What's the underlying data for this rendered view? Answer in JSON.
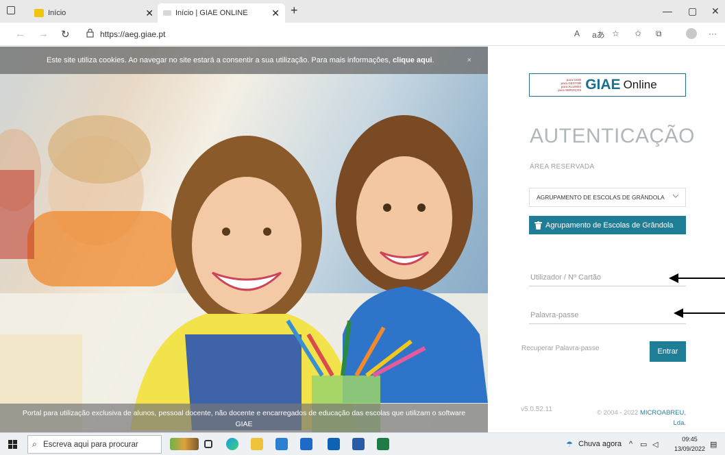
{
  "browser": {
    "tabs": [
      {
        "title": "Início"
      },
      {
        "title": "Início | GIAE ONLINE"
      }
    ],
    "url": "https://aeg.giae.pt",
    "reader_label": "A",
    "translate_label": "aあ"
  },
  "cookie_banner": {
    "text": "Este site utiliza cookies. Ao navegar no site estará a consentir a sua utilização. Para mais informações,",
    "link": "clique aqui",
    "close": "×"
  },
  "footer_note": "Portal para utilização exclusiva de alunos, pessoal docente, não docente e encarregados de educação das escolas que utilizam o software GIAE",
  "login": {
    "logo_tagline": [
      "para GIAE",
      "para GESTOR",
      "para ALUNOS",
      "para SERVIÇOS"
    ],
    "logo_brand": "GIAE",
    "logo_suffix": "Online",
    "title": "AUTENTICAÇÃO",
    "area": "ÁREA RESERVADA",
    "school_select": "AGRUPAMENTO DE ESCOLAS DE GRÂNDOLA",
    "school_button": "Agrupamento de Escolas de Grândola",
    "username_placeholder": "Utilizador / Nº Cartão",
    "password_placeholder": "Palavra-passe",
    "recover": "Recuperar Palavra-passe",
    "enter": "Entrar",
    "version": "v5.0.52.11",
    "copyright": "© 2004 - 2022",
    "company": "MICROABREU,",
    "company_suffix": "Lda."
  },
  "taskbar": {
    "search_placeholder": "Escreva aqui para procurar",
    "weather": "Chuva agora",
    "time": "09:45",
    "date": "13/09/2022"
  },
  "colors": {
    "accent": "#1f7d96",
    "brand": "#1b6f8d"
  }
}
